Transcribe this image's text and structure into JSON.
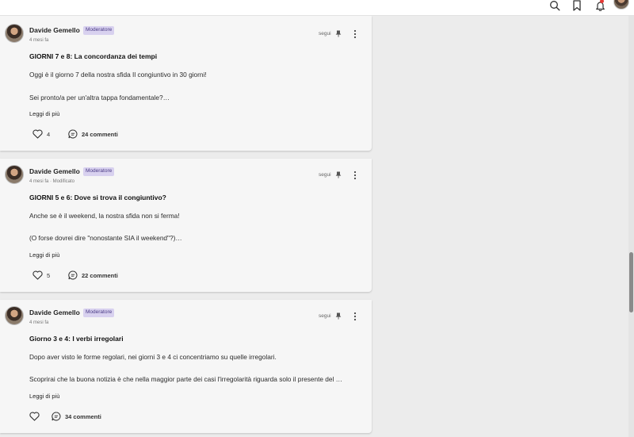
{
  "header": {
    "icons": [
      "search-icon",
      "bookmark-icon",
      "bell-icon",
      "user-avatar"
    ]
  },
  "posts": [
    {
      "author": "Davide Gemello",
      "badge": "Moderatore",
      "meta": "4 mesi fa",
      "follow_label": "segui",
      "title": "GIORNI 7 e 8: La concordanza dei tempi",
      "line1": "Oggi è il giorno 7 della nostra sfida Il congiuntivo in 30 giorni!",
      "line2": "Sei pronto/a per un'altra tappa fondamentale?…",
      "read_more": "Leggi di più",
      "likes": "4",
      "comments": "24 commenti"
    },
    {
      "author": "Davide Gemello",
      "badge": "Moderatore",
      "meta": "4 mesi fa · Modificato",
      "follow_label": "segui",
      "title": "GIORNI 5 e 6: Dove si trova il congiuntivo?",
      "line1": "Anche se è il weekend, la nostra sfida non si ferma!",
      "line2": "(O forse dovrei dire \"nonostante SIA il weekend\"?)…",
      "read_more": "Leggi di più",
      "likes": "5",
      "comments": "22 commenti"
    },
    {
      "author": "Davide Gemello",
      "badge": "Moderatore",
      "meta": "4 mesi fa",
      "follow_label": "segui",
      "title": "Giorno 3 e 4: I verbi irregolari",
      "line1": "Dopo aver visto le forme regolari, nei giorni 3 e 4 ci concentriamo su quelle irregolari.",
      "line2": "Scoprirai che la buona notizia è che nella maggior parte dei casi l'irregolarità riguarda solo il presente del …",
      "read_more": "Leggi di più",
      "likes": "",
      "comments": "34 commenti"
    }
  ],
  "colors": {
    "badge_bg": "#d8d1ef",
    "badge_text": "#4b3c86",
    "notification_dot": "#e53935"
  }
}
